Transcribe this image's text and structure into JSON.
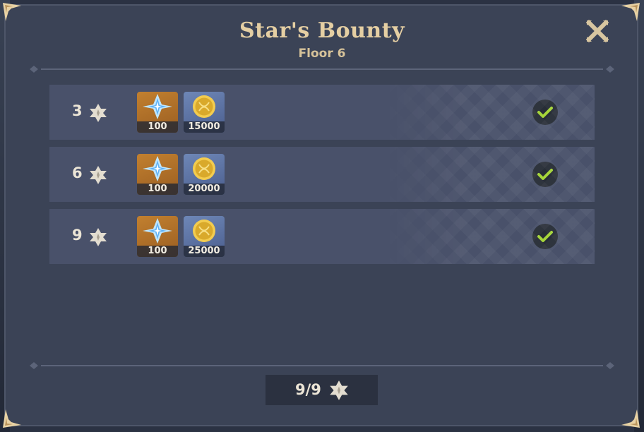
{
  "window": {
    "title": "Star's Bounty",
    "subtitle": "Floor 6"
  },
  "rewards": [
    {
      "stars_required": "3",
      "items": [
        {
          "icon": "primogem-icon",
          "count": "100"
        },
        {
          "icon": "mora-coin-icon",
          "count": "15000"
        }
      ],
      "status": "claimed"
    },
    {
      "stars_required": "6",
      "items": [
        {
          "icon": "primogem-icon",
          "count": "100"
        },
        {
          "icon": "mora-coin-icon",
          "count": "20000"
        }
      ],
      "status": "claimed"
    },
    {
      "stars_required": "9",
      "items": [
        {
          "icon": "primogem-icon",
          "count": "100"
        },
        {
          "icon": "mora-coin-icon",
          "count": "25000"
        }
      ],
      "status": "claimed"
    }
  ],
  "footer": {
    "total": "9/9"
  },
  "colors": {
    "panel": "#3b4356",
    "row": "#49516a",
    "title_gold": "#e5cfa3",
    "check_green": "#a6d63a"
  }
}
